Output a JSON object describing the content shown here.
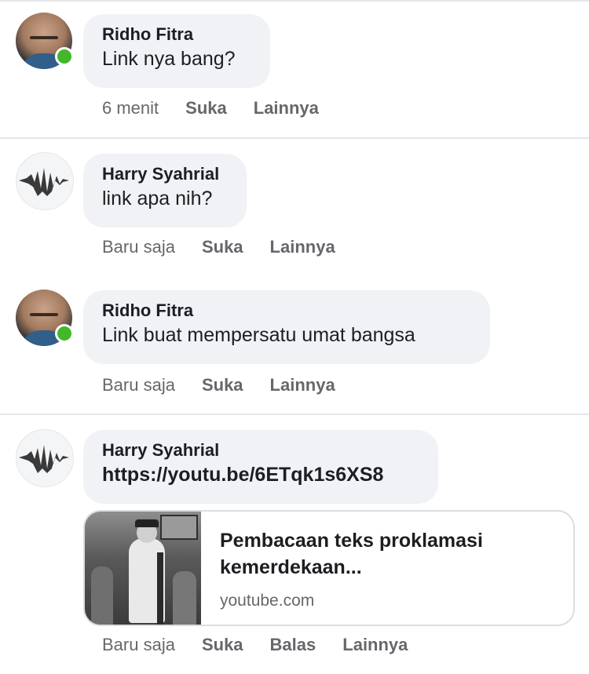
{
  "comments": [
    {
      "author": "Ridho Fitra",
      "text": "Link nya bang?",
      "time": "6 menit",
      "actions": [
        "Suka",
        "Lainnya"
      ]
    },
    {
      "author": "Harry Syahrial",
      "text": "link apa nih?",
      "time": "Baru saja",
      "actions": [
        "Suka",
        "Lainnya"
      ]
    },
    {
      "author": "Ridho Fitra",
      "text": "Link buat mempersatu umat bangsa",
      "time": "Baru saja",
      "actions": [
        "Suka",
        "Lainnya"
      ]
    },
    {
      "author": "Harry Syahrial",
      "text": "https://youtu.be/6ETqk1s6XS8",
      "time": "Baru saja",
      "actions": [
        "Suka",
        "Balas",
        "Lainnya"
      ],
      "link_preview": {
        "title": "Pembacaan teks proklamasi kemerdekaan...",
        "domain": "youtube.com"
      }
    }
  ],
  "colors": {
    "bubble": "#f0f2f5",
    "online": "#42b72a",
    "meta_text": "#65676b"
  }
}
